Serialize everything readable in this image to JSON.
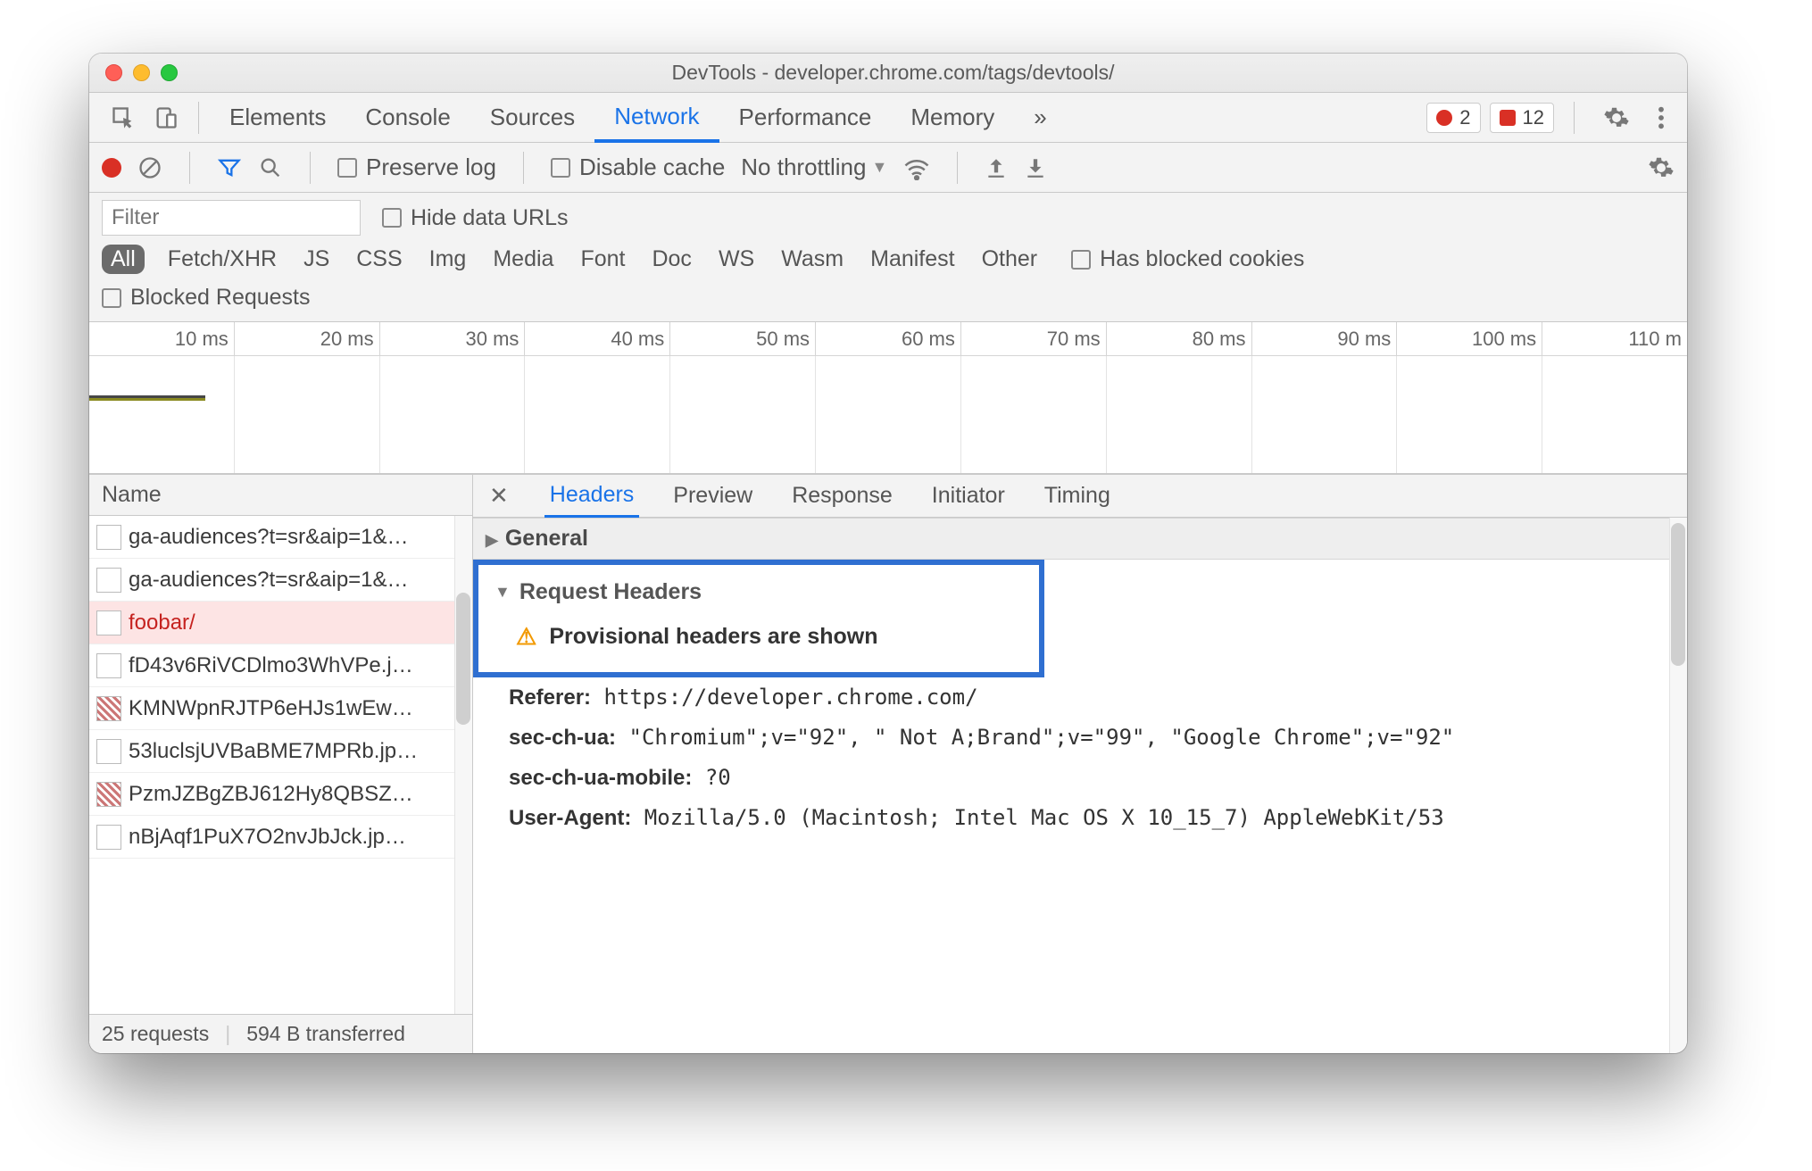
{
  "window": {
    "title": "DevTools - developer.chrome.com/tags/devtools/"
  },
  "tabs": {
    "items": [
      "Elements",
      "Console",
      "Sources",
      "Network",
      "Performance",
      "Memory"
    ],
    "more_icon": "»",
    "active_index": 3,
    "errors_circle": "2",
    "errors_square": "12"
  },
  "net_toolbar": {
    "preserve_log": "Preserve log",
    "disable_cache": "Disable cache",
    "throttling": "No throttling"
  },
  "filter": {
    "placeholder": "Filter",
    "hide_data_urls": "Hide data URLs",
    "types": [
      "All",
      "Fetch/XHR",
      "JS",
      "CSS",
      "Img",
      "Media",
      "Font",
      "Doc",
      "WS",
      "Wasm",
      "Manifest",
      "Other"
    ],
    "has_blocked_cookies": "Has blocked cookies",
    "blocked_requests": "Blocked Requests"
  },
  "timeline_ticks": [
    "10 ms",
    "20 ms",
    "30 ms",
    "40 ms",
    "50 ms",
    "60 ms",
    "70 ms",
    "80 ms",
    "90 ms",
    "100 ms",
    "110 m"
  ],
  "requests": {
    "header": "Name",
    "items": [
      {
        "name": "ga-audiences?t=sr&aip=1&…",
        "err": false,
        "photo": false
      },
      {
        "name": "ga-audiences?t=sr&aip=1&…",
        "err": false,
        "photo": false
      },
      {
        "name": "foobar/",
        "err": true,
        "photo": false
      },
      {
        "name": "fD43v6RiVCDlmo3WhVPe.j…",
        "err": false,
        "photo": false
      },
      {
        "name": "KMNWpnRJTP6eHJs1wEw…",
        "err": false,
        "photo": true
      },
      {
        "name": "53luclsjUVBaBME7MPRb.jp…",
        "err": false,
        "photo": false
      },
      {
        "name": "PzmJZBgZBJ612Hy8QBSZ…",
        "err": false,
        "photo": true
      },
      {
        "name": "nBjAqf1PuX7O2nvJbJck.jp…",
        "err": false,
        "photo": false
      }
    ],
    "status": {
      "count": "25 requests",
      "transferred": "594 B transferred"
    }
  },
  "detail": {
    "tabs": [
      "Headers",
      "Preview",
      "Response",
      "Initiator",
      "Timing"
    ],
    "active_index": 0,
    "general_title": "General",
    "request_headers_title": "Request Headers",
    "provisional_warning": "Provisional headers are shown",
    "headers": {
      "Referer": "https://developer.chrome.com/",
      "sec-ch-ua": "\"Chromium\";v=\"92\", \" Not A;Brand\";v=\"99\", \"Google Chrome\";v=\"92\"",
      "sec-ch-ua-mobile": "?0",
      "User-Agent": "Mozilla/5.0 (Macintosh; Intel Mac OS X 10_15_7) AppleWebKit/53"
    }
  }
}
